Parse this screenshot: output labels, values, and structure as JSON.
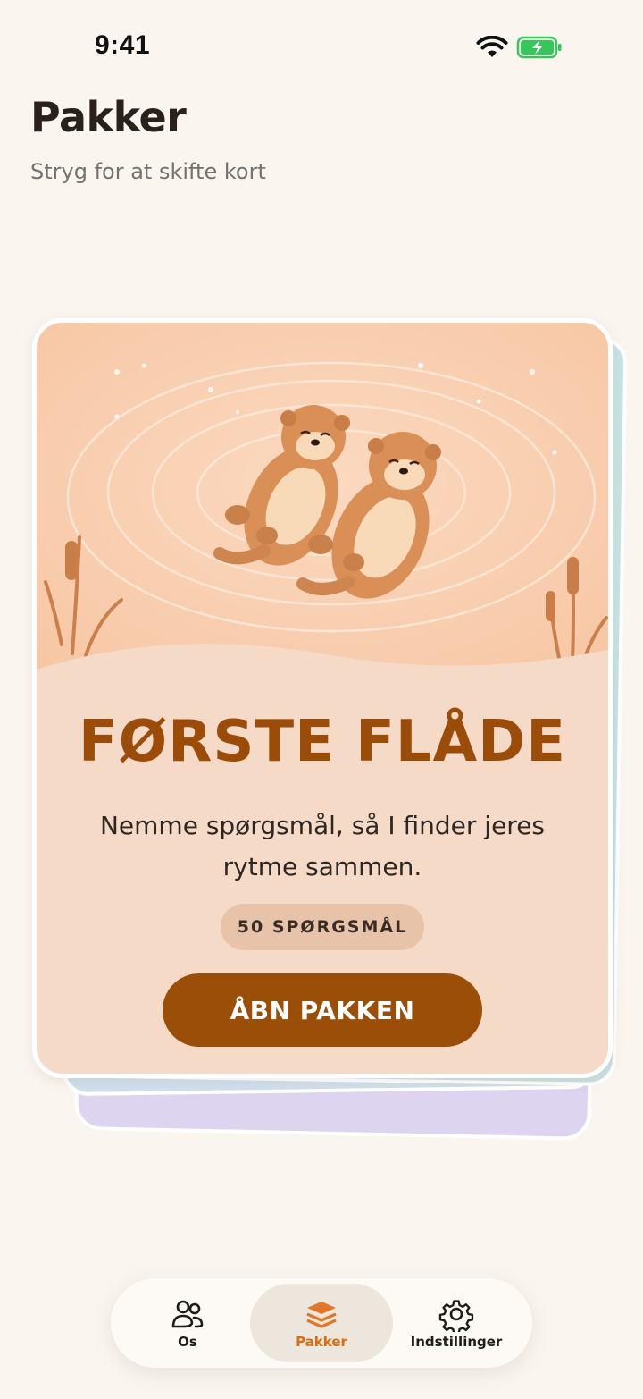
{
  "status_bar": {
    "time": "9:41"
  },
  "header": {
    "title": "Pakker",
    "subtitle": "Stryg for at skifte kort"
  },
  "card": {
    "title": "FØRSTE FLÅDE",
    "description": "Nemme spørgsmål, så I finder jeres rytme sammen.",
    "question_count": "50 SPØRGSMÅL",
    "open_button": "ÅBN PAKKEN",
    "colors": {
      "background": "#f4dac7",
      "title": "#9b4c08",
      "button": "#9b4e07",
      "badge": "#e7c3a9"
    }
  },
  "tab_bar": {
    "tabs": [
      {
        "label": "Os",
        "icon": "people-icon",
        "active": false
      },
      {
        "label": "Pakker",
        "icon": "stack-icon",
        "active": true
      },
      {
        "label": "Indstillinger",
        "icon": "gear-icon",
        "active": false
      }
    ],
    "active_color": "#d86c15"
  }
}
